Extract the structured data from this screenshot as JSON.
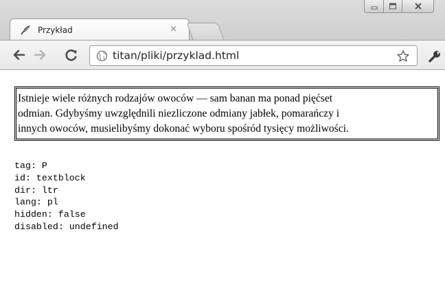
{
  "window": {
    "controls": {
      "minimize": "minimize-icon",
      "maximize": "maximize-icon",
      "close": "close-icon"
    }
  },
  "tab": {
    "title": "Przykład",
    "close_glyph": "×",
    "favicon": "quill-icon"
  },
  "toolbar": {
    "url": "titan/pliki/przyklad.html",
    "icons": [
      "back-arrow-icon",
      "forward-arrow-icon",
      "reload-icon",
      "globe-icon",
      "star-icon",
      "wrench-icon"
    ]
  },
  "page": {
    "textblock_lines": [
      "Istnieje wiele różnych rodzajów owoców — sam banan ma ponad pięćset",
      "odmian. Gdybyśmy uwzględnili niezliczone odmiany jabłek, pomarańczy i",
      "innych owoców, musielibyśmy dokonać wyboru spośród tysięcy możliwości."
    ],
    "properties": [
      "tag: P",
      "id: textblock",
      "dir: ltr",
      "lang: pl",
      "hidden: false",
      "disabled: undefined"
    ]
  },
  "colors": {
    "chrome_frame": "#d4d4d4",
    "toolbar": "#eeeeee",
    "page_background": "#ffffff",
    "text": "#000000"
  }
}
